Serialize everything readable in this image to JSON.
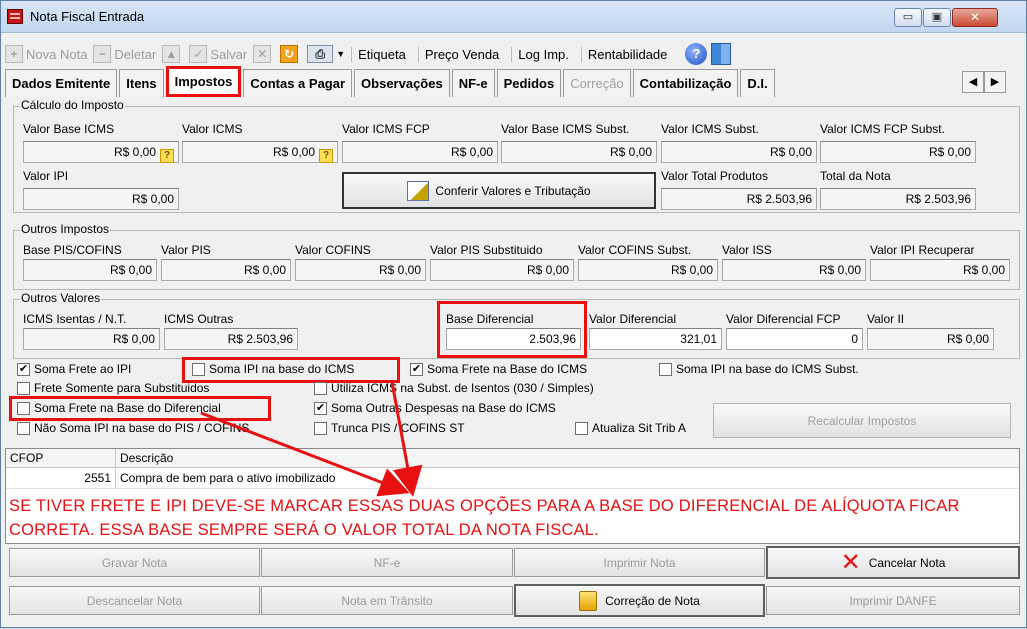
{
  "window": {
    "title": "Nota Fiscal Entrada",
    "min": "▭",
    "max": "▣",
    "close": "✕"
  },
  "toolbar": {
    "nova": "Nova Nota",
    "deletar": "Deletar",
    "salvar": "Salvar",
    "etiqueta": "Etiqueta",
    "preco": "Preço Venda",
    "log": "Log Imp.",
    "rentabilidade": "Rentabilidade"
  },
  "tabs": [
    "Dados Emitente",
    "Itens",
    "Impostos",
    "Contas a Pagar",
    "Observações",
    "NF-e",
    "Pedidos",
    "Correção",
    "Contabilização",
    "D.I."
  ],
  "calculo": {
    "title": "Cálculo do Imposto",
    "labels": [
      "Valor Base ICMS",
      "Valor ICMS",
      "Valor ICMS FCP",
      "Valor Base ICMS Subst.",
      "Valor ICMS Subst.",
      "Valor ICMS FCP Subst."
    ],
    "values": [
      "R$ 0,00",
      "R$ 0,00",
      "R$ 0,00",
      "R$ 0,00",
      "R$ 0,00",
      "R$ 0,00"
    ],
    "ipi_label": "Valor IPI",
    "ipi_value": "R$ 0,00",
    "conferir": "Conferir Valores e Tributação",
    "total_prod_label": "Valor Total Produtos",
    "total_prod_value": "R$ 2.503,96",
    "total_nota_label": "Total da Nota",
    "total_nota_value": "R$ 2.503,96"
  },
  "outros_impostos": {
    "title": "Outros Impostos",
    "labels": [
      "Base PIS/COFINS",
      "Valor PIS",
      "Valor COFINS",
      "Valor PIS Substituido",
      "Valor COFINS Subst.",
      "Valor ISS",
      "Valor IPI Recuperar"
    ],
    "values": [
      "R$ 0,00",
      "R$ 0,00",
      "R$ 0,00",
      "R$ 0,00",
      "R$ 0,00",
      "R$ 0,00",
      "R$ 0,00"
    ]
  },
  "outros_valores": {
    "title": "Outros Valores",
    "labels": [
      "ICMS Isentas / N.T.",
      "ICMS Outras",
      "Base Diferencial",
      "Valor Diferencial",
      "Valor Diferencial FCP",
      "Valor II"
    ],
    "values": [
      "R$ 0,00",
      "R$ 2.503,96",
      "2.503,96",
      "321,01",
      "0",
      "R$ 0,00"
    ]
  },
  "checks": {
    "soma_frete_ipi": "Soma Frete ao IPI",
    "soma_ipi_base_icms": "Soma IPI na base do ICMS",
    "soma_frete_base_icms": "Soma Frete na Base do ICMS",
    "soma_ipi_base_icms_subst": "Soma IPI na base do ICMS Subst.",
    "frete_somente": "Frete Somente para Substituidos",
    "utiliza_icms": "Utiliza ICMS na Subst. de Isentos (030 / Simples)",
    "soma_frete_diferencial": "Soma Frete na Base do Diferencial",
    "soma_outras": "Soma Outras Despesas na Base do ICMS",
    "nao_soma_ipi": "Não Soma IPI na base do PIS / COFINS",
    "trunca": "Trunca PIS / COFINS ST",
    "atualiza": "Atualiza Sit Trib A",
    "recalcular": "Recalcular Impostos"
  },
  "grid": {
    "headers": [
      "CFOP",
      "Descrição"
    ],
    "rows": [
      {
        "cfop": "2551",
        "descricao": "Compra de bem para o ativo imobilizado"
      }
    ]
  },
  "annotation": {
    "line1": "SE TIVER FRETE E IPI DEVE-SE MARCAR ESSAS DUAS OPÇÕES PARA A BASE DO DIFERENCIAL DE ALÍQUOTA FICAR",
    "line2": "CORRETA. ESSA BASE SEMPRE SERÁ O VALOR TOTAL DA NOTA FISCAL."
  },
  "bottom": {
    "gravar": "Gravar Nota",
    "nfe": "NF-e",
    "imprimir": "Imprimir Nota",
    "cancelar": "Cancelar Nota",
    "descancelar": "Descancelar Nota",
    "transito": "Nota em Trânsito",
    "correcao": "Correção de Nota",
    "danfe": "Imprimir DANFE"
  },
  "colors": {
    "accent_red": "#e81010"
  }
}
